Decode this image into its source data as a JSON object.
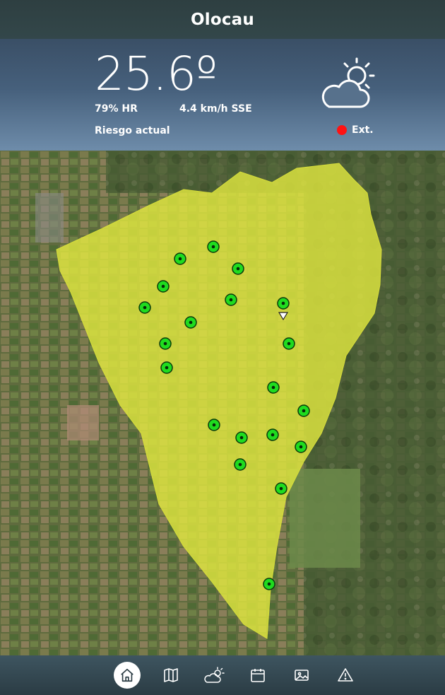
{
  "header": {
    "title": "Olocau"
  },
  "weather": {
    "temperature": "25.6º",
    "humidity": "79% HR",
    "wind": "4.4 km/h SSE",
    "risk_label": "Riesgo actual",
    "risk_level": "Ext.",
    "risk_color": "#ff1212",
    "icon": "partly-cloudy-sun-icon"
  },
  "map": {
    "area_color": "#dfe640",
    "marker_color": "#1fdc1f",
    "marker_count": 22
  },
  "nav": {
    "items": [
      {
        "name": "home",
        "icon": "home-icon",
        "active": true
      },
      {
        "name": "map",
        "icon": "map-icon",
        "active": false
      },
      {
        "name": "forecast",
        "icon": "weather-icon",
        "active": false
      },
      {
        "name": "calendar",
        "icon": "calendar-icon",
        "active": false
      },
      {
        "name": "gallery",
        "icon": "image-icon",
        "active": false
      },
      {
        "name": "alerts",
        "icon": "alert-icon",
        "active": false
      }
    ]
  }
}
